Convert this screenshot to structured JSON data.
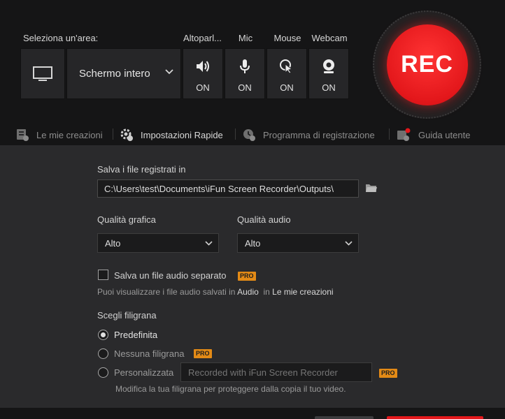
{
  "header": {
    "area_label": "Seleziona un'area:",
    "area_value": "Schermo intero",
    "toggles": [
      {
        "label": "Altoparl...",
        "state": "ON",
        "icon": "speaker-icon"
      },
      {
        "label": "Mic",
        "state": "ON",
        "icon": "mic-icon"
      },
      {
        "label": "Mouse",
        "state": "ON",
        "icon": "mouse-cursor-icon"
      },
      {
        "label": "Webcam",
        "state": "ON",
        "icon": "webcam-icon"
      }
    ],
    "rec_label": "REC",
    "rec_color": "#e3171b"
  },
  "nav": {
    "items": [
      {
        "label": "Le mie creazioni",
        "icon": "list-check-icon"
      },
      {
        "label": "Impostazioni Rapide",
        "icon": "gear-icon"
      },
      {
        "label": "Programma di registrazione",
        "icon": "clock-icon"
      },
      {
        "label": "Guida utente",
        "icon": "guide-icon"
      }
    ]
  },
  "settings": {
    "save_label": "Salva i file registrati in",
    "save_path": "C:\\Users\\test\\Documents\\iFun Screen Recorder\\Outputs\\",
    "video_quality_label": "Qualità grafica",
    "video_quality_value": "Alto",
    "audio_quality_label": "Qualità audio",
    "audio_quality_value": "Alto",
    "separate_audio_label": "Salva un file audio separato",
    "separate_audio_checked": false,
    "pro_badge": "PRO",
    "hint_prefix": "Puoi visualizzare i file audio salvati in",
    "hint_audio": "Audio",
    "hint_in": "in",
    "hint_creations": "Le mie creazioni",
    "watermark_label": "Scegli filigrana",
    "watermark_options": [
      {
        "label": "Predefinita",
        "checked": true
      },
      {
        "label": "Nessuna filigrana",
        "checked": false
      },
      {
        "label": "Personalizzata",
        "checked": false
      }
    ],
    "watermark_placeholder": "Recorded with iFun Screen Recorder",
    "watermark_hint": "Modifica la tua filigrana per proteggere dalla copia il tuo video.",
    "accent_pro": "#e38a16"
  }
}
